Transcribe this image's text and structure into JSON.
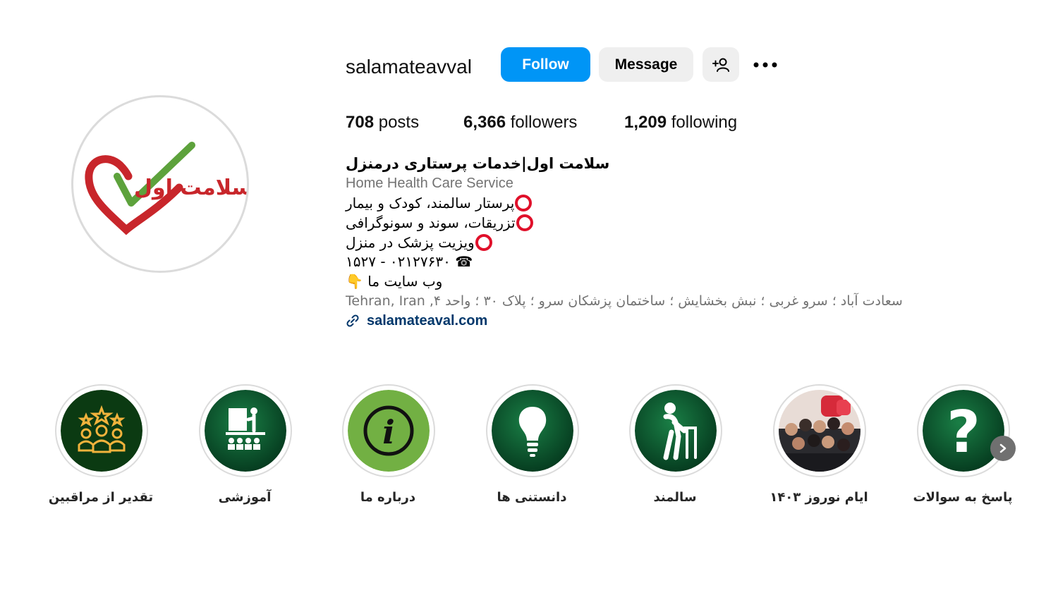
{
  "profile": {
    "username": "salamateavval",
    "avatar_icon": "logo-heart-check",
    "avatar_logo_text": "سلامت اول"
  },
  "actions": {
    "follow_label": "Follow",
    "message_label": "Message",
    "suggest_icon": "add-person-icon",
    "more_icon": "more-dots-icon"
  },
  "stats": {
    "posts_count": "708",
    "posts_label": "posts",
    "followers_count": "6,366",
    "followers_label": "followers",
    "following_count": "1,209",
    "following_label": "following"
  },
  "bio": {
    "name": "سلامت اول|خدمات پرستاری درمنزل",
    "category": "Home Health Care Service",
    "line1": "پرستار سالمند، کودک و بیمار",
    "line2": "تزریقات، سوند و سونوگرافی",
    "line3": "ویزیت پزشک در منزل",
    "phone": "☎ ۰۲۱۲۷۶۳۰ - ۱۵۲۷",
    "website_line": "وب سایت ما 👇",
    "address": "سعادت آباد ؛ سرو غربی ؛ نبش بخشایش ؛ ساختمان پزشکان سرو ؛ پلاک ۳۰ ؛ واحد ۴, Tehran, Iran",
    "link": "salamateaval.com",
    "link_icon": "link-icon"
  },
  "highlights": [
    {
      "label": "پاسخ به سوالات",
      "icon": "question-mark-icon"
    },
    {
      "label": "ایام نوروز ۱۴۰۳",
      "icon": "group-photo"
    },
    {
      "label": "سالمند",
      "icon": "elderly-walker-icon"
    },
    {
      "label": "دانستنی ها",
      "icon": "lightbulb-icon"
    },
    {
      "label": "درباره ما",
      "icon": "info-icon"
    },
    {
      "label": "آموزشی",
      "icon": "presentation-icon"
    },
    {
      "label": "تقدیر از مراقبین",
      "icon": "star-team-icon"
    }
  ],
  "highlights_next_icon": "chevron-right-icon",
  "colors": {
    "primary_blue": "#0095f6",
    "secondary_button": "#efefef",
    "link_color": "#00376b",
    "muted_text": "#737373",
    "highlight_green": "#0b5e33",
    "info_green": "#72b043"
  }
}
